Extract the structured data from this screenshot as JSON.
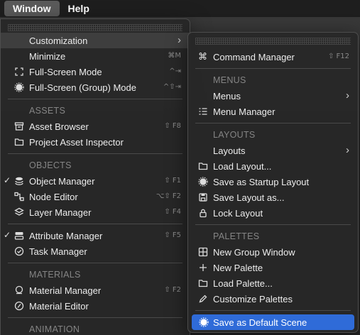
{
  "menubar": {
    "window": "Window",
    "help": "Help"
  },
  "window_menu": {
    "customization": "Customization",
    "minimize": "Minimize",
    "minimize_sc": "⌘M",
    "fullscreen": "Full-Screen Mode",
    "fullscreen_sc": "^⇥",
    "fullscreen_group": "Full-Screen (Group) Mode",
    "fullscreen_group_sc": "^⇧⇥",
    "assets_header": "ASSETS",
    "asset_browser": "Asset Browser",
    "asset_browser_sc": "⇧ F8",
    "project_asset_inspector": "Project Asset Inspector",
    "objects_header": "OBJECTS",
    "object_manager": "Object Manager",
    "object_manager_sc": "⇧ F1",
    "node_editor": "Node Editor",
    "node_editor_sc": "⌥⇧ F2",
    "layer_manager": "Layer Manager",
    "layer_manager_sc": "⇧ F4",
    "attribute_manager": "Attribute Manager",
    "attribute_manager_sc": "⇧ F5",
    "task_manager": "Task Manager",
    "materials_header": "MATERIALS",
    "material_manager": "Material Manager",
    "material_manager_sc": "⇧ F2",
    "material_editor": "Material Editor",
    "animation_header": "ANIMATION"
  },
  "submenu": {
    "command_manager": "Command Manager",
    "command_manager_sc": "⇧ F12",
    "menus_header": "MENUS",
    "menus": "Menus",
    "menu_manager": "Menu Manager",
    "layouts_header": "LAYOUTS",
    "layouts": "Layouts",
    "load_layout": "Load Layout...",
    "save_startup_layout": "Save as Startup Layout",
    "save_layout_as": "Save Layout as...",
    "lock_layout": "Lock Layout",
    "palettes_header": "PALETTES",
    "new_group_window": "New Group Window",
    "new_palette": "New Palette",
    "load_palette": "Load Palette...",
    "customize_palettes": "Customize Palettes",
    "save_default_scene": "Save as Default Scene"
  },
  "colors": {
    "selection": "#2f6bd8",
    "menu_bg": "#282828",
    "header_text": "#858585"
  }
}
